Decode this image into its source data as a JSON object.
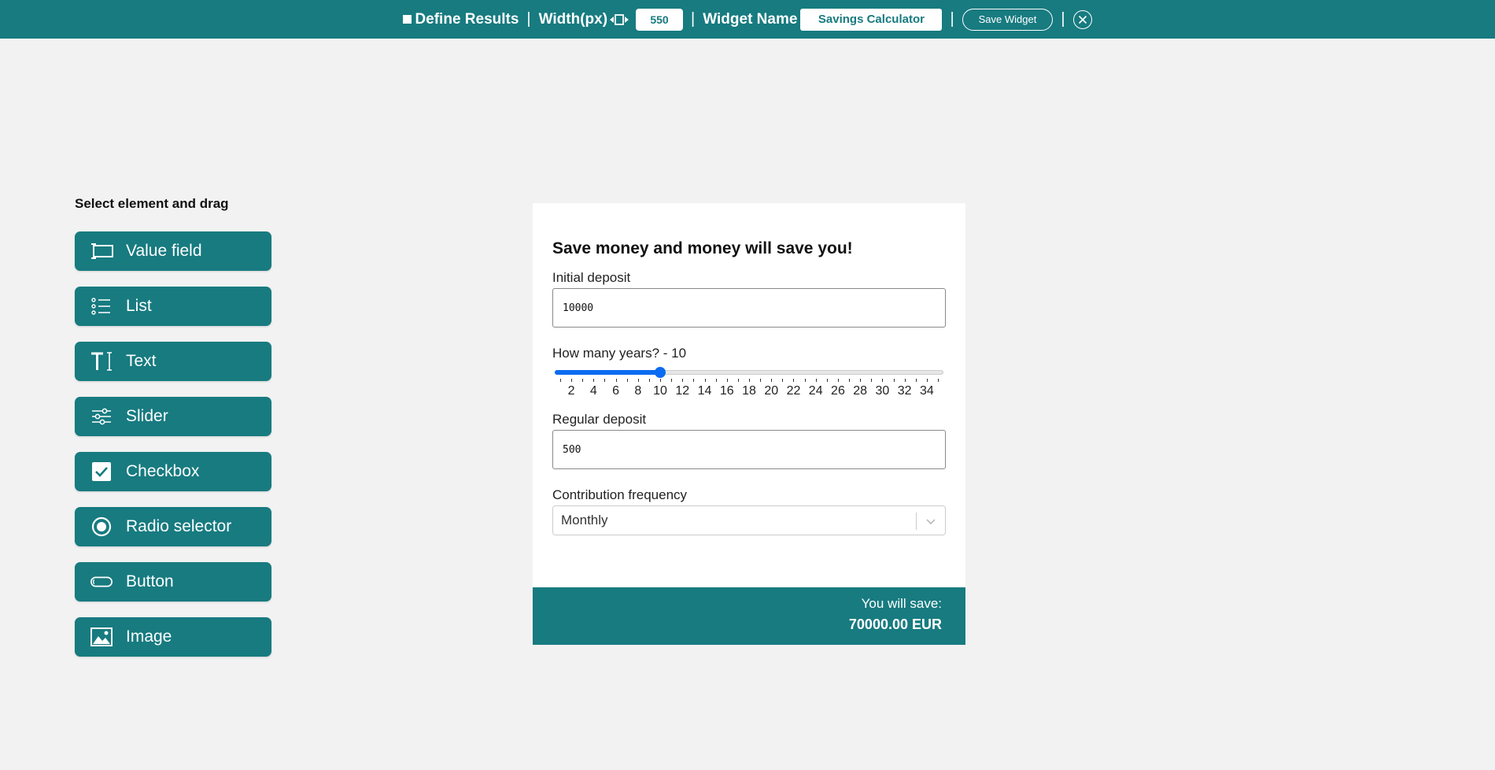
{
  "topbar": {
    "define_results_label": "Define Results",
    "separator": "|",
    "width_label": "Width(px)",
    "width_value": "550",
    "widget_name_label": "Widget Name",
    "widget_name_value": "Savings Calculator",
    "save_label": "Save Widget"
  },
  "palette": {
    "title": "Select element and drag",
    "items": [
      {
        "label": "Value field",
        "icon": "value-field-icon"
      },
      {
        "label": "List",
        "icon": "list-icon"
      },
      {
        "label": "Text",
        "icon": "text-icon"
      },
      {
        "label": "Slider",
        "icon": "slider-icon"
      },
      {
        "label": "Checkbox",
        "icon": "checkbox-icon"
      },
      {
        "label": "Radio selector",
        "icon": "radio-icon"
      },
      {
        "label": "Button",
        "icon": "button-icon"
      },
      {
        "label": "Image",
        "icon": "image-icon"
      }
    ]
  },
  "widget": {
    "heading": "Save money and money will save you!",
    "initial_deposit": {
      "label": "Initial deposit",
      "value": "10000"
    },
    "years": {
      "label": "How many years? - 10",
      "min": 1,
      "max": 35,
      "value": 10,
      "tick_labels": [
        "2",
        "4",
        "6",
        "8",
        "10",
        "12",
        "14",
        "16",
        "18",
        "20",
        "22",
        "24",
        "26",
        "28",
        "30",
        "32",
        "34"
      ]
    },
    "regular_deposit": {
      "label": "Regular deposit",
      "value": "500"
    },
    "frequency": {
      "label": "Contribution frequency",
      "selected": "Monthly"
    },
    "result": {
      "label": "You will save:",
      "value": "70000.00 EUR"
    }
  },
  "colors": {
    "brand": "#177b80",
    "accent": "#0a6cf0",
    "background": "#f2f2f2"
  }
}
